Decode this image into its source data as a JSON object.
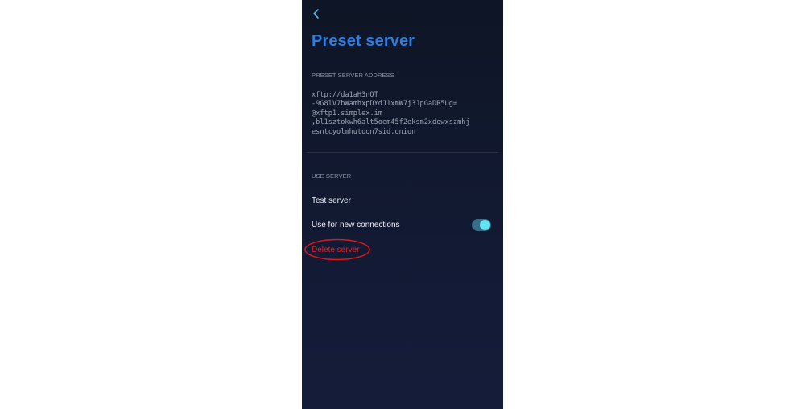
{
  "header": {
    "title": "Preset server",
    "back_icon": "chevron-left-icon"
  },
  "address_section": {
    "label": "PRESET SERVER ADDRESS",
    "lines": [
      "xftp://da1aH3nOT",
      "-9G8lV7bWamhxpDYdJ1xmW7j3JpGaDR5Ug=",
      "@xftp1.simplex.im",
      ",bl1sztokwh6alt5oem45f2eksm2xdowxszmhj",
      "esntcyolmhutoon7sid.onion"
    ]
  },
  "use_section": {
    "label": "USE SERVER",
    "test_server": "Test server",
    "use_for_new_connections": "Use for new connections",
    "toggle_on": true,
    "delete_server": "Delete server"
  },
  "colors": {
    "title": "#2f7de1",
    "background": "#121a33",
    "toggle_track": "#3b6e86",
    "toggle_knob": "#63e3f2",
    "danger": "#e0222b",
    "annotation_oval": "#e0161b"
  }
}
